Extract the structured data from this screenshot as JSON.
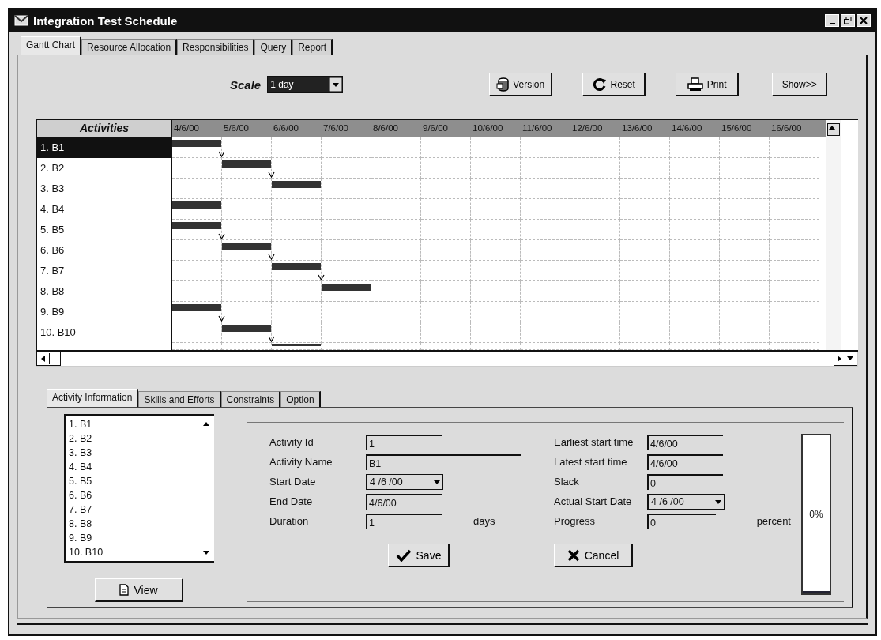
{
  "window": {
    "title": "Integration Test Schedule"
  },
  "tabs": [
    {
      "label": "Gantt Chart",
      "selected": true
    },
    {
      "label": "Resource Allocation",
      "selected": false
    },
    {
      "label": "Responsibilities",
      "selected": false
    },
    {
      "label": "Query",
      "selected": false
    },
    {
      "label": "Report",
      "selected": false
    }
  ],
  "toolbar": {
    "scale_label": "Scale",
    "scale_value": "1 day",
    "buttons": [
      {
        "label": "Version",
        "kind": "version"
      },
      {
        "label": "Reset",
        "kind": "reset"
      },
      {
        "label": "Print",
        "kind": "print"
      },
      {
        "label": "Show>>",
        "kind": "plain"
      }
    ]
  },
  "gantt": {
    "header": "Activities",
    "dates": [
      "4/6/00",
      "5/6/00",
      "6/6/00",
      "7/6/00",
      "8/6/00",
      "9/6/00",
      "10/6/00",
      "11/6/00",
      "12/6/00",
      "13/6/00",
      "14/6/00",
      "15/6/00",
      "16/6/00"
    ],
    "rows": [
      {
        "label": "1. B1",
        "selected": true,
        "schedule": [
          true,
          false,
          false,
          false,
          false,
          false,
          false,
          false,
          false,
          false,
          false,
          false,
          false
        ]
      },
      {
        "label": "2. B2",
        "selected": false,
        "schedule": [
          false,
          true,
          false,
          false,
          false,
          false,
          false,
          false,
          false,
          false,
          false,
          false,
          false
        ]
      },
      {
        "label": "3. B3",
        "selected": false,
        "schedule": [
          false,
          false,
          true,
          false,
          false,
          false,
          false,
          false,
          false,
          false,
          false,
          false,
          false
        ]
      },
      {
        "label": "4. B4",
        "selected": false,
        "schedule": [
          true,
          false,
          false,
          false,
          false,
          false,
          false,
          false,
          false,
          false,
          false,
          false,
          false
        ]
      },
      {
        "label": "5. B5",
        "selected": false,
        "schedule": [
          true,
          false,
          false,
          false,
          false,
          false,
          false,
          false,
          false,
          false,
          false,
          false,
          false
        ]
      },
      {
        "label": "6. B6",
        "selected": false,
        "schedule": [
          false,
          true,
          false,
          false,
          false,
          false,
          false,
          false,
          false,
          false,
          false,
          false,
          false
        ]
      },
      {
        "label": "7. B7",
        "selected": false,
        "schedule": [
          false,
          false,
          true,
          false,
          false,
          false,
          false,
          false,
          false,
          false,
          false,
          false,
          false
        ]
      },
      {
        "label": "8. B8",
        "selected": false,
        "schedule": [
          false,
          false,
          false,
          true,
          false,
          false,
          false,
          false,
          false,
          false,
          false,
          false,
          false
        ]
      },
      {
        "label": "9. B9",
        "selected": false,
        "schedule": [
          true,
          false,
          false,
          false,
          false,
          false,
          false,
          false,
          false,
          false,
          false,
          false,
          false
        ]
      },
      {
        "label": "10. B10",
        "selected": false,
        "schedule": [
          false,
          true,
          false,
          false,
          false,
          false,
          false,
          false,
          false,
          false,
          false,
          false,
          false
        ]
      },
      {
        "schedule": [
          false,
          false,
          true,
          false,
          false,
          false,
          false,
          false,
          false,
          false,
          false,
          false,
          false
        ]
      }
    ]
  },
  "detail_tabs": [
    {
      "label": "Activity Information",
      "selected": true
    },
    {
      "label": "Skills and Efforts",
      "selected": false
    },
    {
      "label": "Constraints",
      "selected": false
    },
    {
      "label": "Option",
      "selected": false
    }
  ],
  "activity_list": {
    "items": [
      "1. B1",
      "2. B2",
      "3. B3",
      "4. B4",
      "5. B5",
      "6. B6",
      "7. B7",
      "8. B8",
      "9. B9",
      "10. B10"
    ]
  },
  "view_button": "View",
  "form": {
    "left_fields": [
      {
        "label": "Activity Id",
        "value": "1",
        "kind": "text"
      },
      {
        "label": "Activity Name",
        "value": "B1",
        "kind": "wide"
      },
      {
        "label": "Start Date",
        "value": "4 /6 /00",
        "kind": "date"
      },
      {
        "label": "End Date",
        "value": "4/6/00",
        "kind": "text"
      },
      {
        "label": "Duration",
        "value": "1",
        "kind": "text",
        "unit": "days"
      }
    ],
    "right_fields": [
      {
        "label": "Earliest start time",
        "value": "4/6/00",
        "kind": "text"
      },
      {
        "label": "Latest start time",
        "value": "4/6/00",
        "kind": "text"
      },
      {
        "label": "Slack",
        "value": "0",
        "kind": "text"
      },
      {
        "label": "Actual Start Date",
        "value": "4 /6 /00",
        "kind": "date"
      },
      {
        "label": "Progress",
        "value": "0",
        "kind": "text",
        "unit": "percent"
      }
    ]
  },
  "save_button": "Save",
  "cancel_button": "Cancel",
  "progress_meter": {
    "level": 0,
    "reading": "0%"
  }
}
